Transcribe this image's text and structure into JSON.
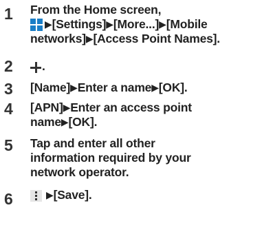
{
  "steps": [
    {
      "number": "1",
      "lines": {
        "l1": "From the Home screen,",
        "l2_a": "[Settings]",
        "l2_b": "[More...]",
        "l2_c": "[Mobile",
        "l3": "networks]",
        "l3_b": "[Access Point Names]."
      },
      "icon": "apps-grid-icon"
    },
    {
      "number": "2",
      "text": ".",
      "icon": "plus-icon"
    },
    {
      "number": "3",
      "parts": {
        "a": "[Name]",
        "b": "Enter a name",
        "c": "[OK]."
      }
    },
    {
      "number": "4",
      "parts": {
        "a": "[APN]",
        "b": "Enter an access point",
        "c": "name",
        "d": "[OK]."
      }
    },
    {
      "number": "5",
      "lines": [
        "Tap and enter all other",
        "information required by your",
        "network operator."
      ]
    },
    {
      "number": "6",
      "text": "[Save].",
      "icon": "menu-overflow-icon"
    }
  ],
  "arrow_glyph": "▶",
  "colors": {
    "icon_blue": "#1a7ec7",
    "text": "#222222"
  }
}
